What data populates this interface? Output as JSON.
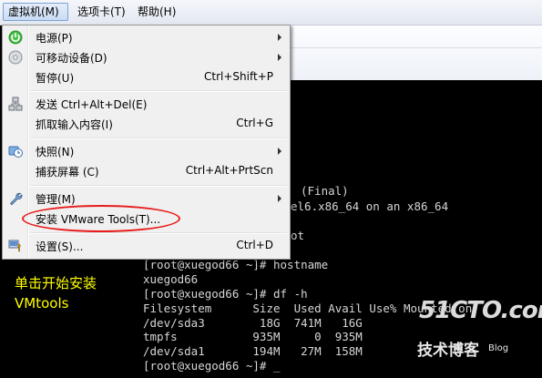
{
  "menubar": {
    "items": [
      "虚拟机(M)",
      "选项卡(T)",
      "帮助(H)"
    ]
  },
  "menu": {
    "power": {
      "label": "电源(P)"
    },
    "removable": {
      "label": "可移动设备(D)"
    },
    "pause": {
      "label": "暂停(U)",
      "shortcut": "Ctrl+Shift+P"
    },
    "send_cad": {
      "label": "发送 Ctrl+Alt+Del(E)"
    },
    "grab_input": {
      "label": "抓取输入内容(I)",
      "shortcut": "Ctrl+G"
    },
    "snapshot": {
      "label": "快照(N)"
    },
    "capture": {
      "label": "捕获屏幕 (C)",
      "shortcut": "Ctrl+Alt+PrtScn"
    },
    "manage": {
      "label": "管理(M)"
    },
    "install_tools": {
      "label": "安装 VMware Tools(T)..."
    },
    "settings": {
      "label": "设置(S)...",
      "shortcut": "Ctrl+D"
    }
  },
  "terminal": {
    "lines": [
      "(Final)",
      "el6.x86_64 on an x86_64",
      "ot",
      "[root@xuegod66 ~]# hostname",
      "xuegod66",
      "[root@xuegod66 ~]# df -h",
      "Filesystem      Size  Used Avail Use% Mounted on",
      "/dev/sda3        18G  741M   16G",
      "tmpfs           935M     0  935M",
      "/dev/sda1       194M   27M  158M",
      "[root@xuegod66 ~]# _"
    ]
  },
  "annotation": {
    "text": "单击开始安装VMtools"
  },
  "watermark": {
    "brand": "51CTO.com",
    "tagline": "技术博客",
    "blog": "Blog"
  },
  "colors": {
    "highlight": "#e81c1c",
    "annotation": "#ffff00"
  }
}
